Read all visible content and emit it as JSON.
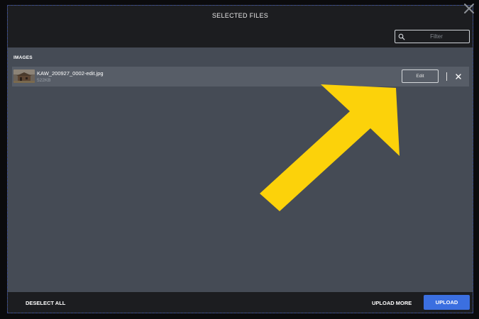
{
  "modal": {
    "title": "SELECTED FILES"
  },
  "filter": {
    "placeholder": "Filter",
    "value": ""
  },
  "section": {
    "label": "IMAGES"
  },
  "files": [
    {
      "name": "KAW_200927_0002-edit.jpg",
      "size": "522KB",
      "edit_label": "Edit"
    }
  ],
  "footer": {
    "deselect_label": "DESELECT ALL",
    "upload_more_label": "UPLOAD MORE",
    "upload_label": "UPLOAD"
  },
  "colors": {
    "accent": "#3b6fe0",
    "annotation_arrow": "#fcd20a",
    "panel": "#454b55",
    "header": "#1c1d20"
  },
  "icons": {
    "close": "close-icon",
    "search": "search-icon",
    "remove": "remove-file-icon",
    "annotation": "arrow-icon"
  }
}
